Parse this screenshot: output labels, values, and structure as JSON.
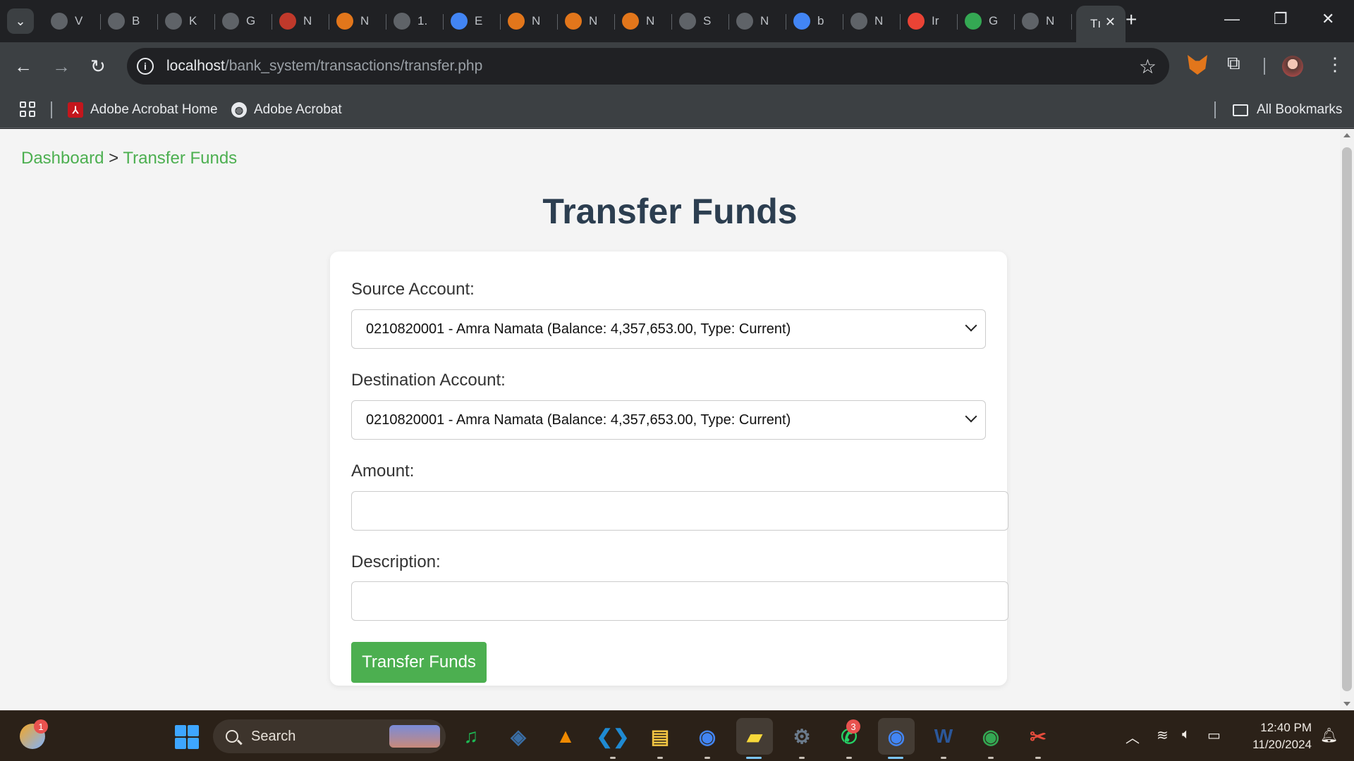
{
  "browser": {
    "tabs": [
      {
        "icon": "chrome-icon",
        "label": "V",
        "color": "#5f6368"
      },
      {
        "icon": "openai-icon",
        "label": "B",
        "color": "#5f6368"
      },
      {
        "icon": "github-icon",
        "label": "K",
        "color": "#5f6368"
      },
      {
        "icon": "globe-icon",
        "label": "G",
        "color": "#5f6368"
      },
      {
        "icon": "bookmark-icon",
        "label": "N",
        "color": "#c0392b"
      },
      {
        "icon": "metamask-icon",
        "label": "N",
        "color": "#e2761b"
      },
      {
        "icon": "globe-icon",
        "label": "1.",
        "color": "#5f6368"
      },
      {
        "icon": "cloud-icon",
        "label": "E",
        "color": "#4285f4"
      },
      {
        "icon": "metamask-icon",
        "label": "N",
        "color": "#e2761b"
      },
      {
        "icon": "metamask-icon",
        "label": "N",
        "color": "#e2761b"
      },
      {
        "icon": "metamask-icon",
        "label": "N",
        "color": "#e2761b"
      },
      {
        "icon": "chart-icon",
        "label": "S",
        "color": "#5f6368"
      },
      {
        "icon": "github-icon",
        "label": "N",
        "color": "#5f6368"
      },
      {
        "icon": "google-icon",
        "label": "b",
        "color": "#4285f4"
      },
      {
        "icon": "chrome-icon",
        "label": "N",
        "color": "#5f6368"
      },
      {
        "icon": "gmail-icon",
        "label": "Ir",
        "color": "#ea4335"
      },
      {
        "icon": "google-lens-icon",
        "label": "G",
        "color": "#34a853"
      },
      {
        "icon": "chrome-icon",
        "label": "N",
        "color": "#5f6368"
      }
    ],
    "active_tab": {
      "label": "Tı"
    },
    "url": {
      "host": "localhost",
      "path": "/bank_system/transactions/transfer.php"
    },
    "bookmarks": [
      {
        "label": "Adobe Acrobat Home"
      },
      {
        "label": "Adobe Acrobat"
      }
    ],
    "all_bookmarks_label": "All Bookmarks"
  },
  "page": {
    "breadcrumb": {
      "home": "Dashboard",
      "separator": ">",
      "current": "Transfer Funds"
    },
    "title": "Transfer Funds",
    "form": {
      "source_label": "Source Account:",
      "source_value": "0210820001 - Amra Namata (Balance: 4,357,653.00, Type: Current)",
      "destination_label": "Destination Account:",
      "destination_value": "0210820001 - Amra Namata (Balance: 4,357,653.00, Type: Current)",
      "amount_label": "Amount:",
      "amount_value": "",
      "description_label": "Description:",
      "description_value": "",
      "submit_label": "Transfer Funds"
    },
    "colors": {
      "accent": "#4caf50",
      "title": "#2c3e50",
      "background": "#f4f4f4"
    }
  },
  "taskbar": {
    "weather_badge": "1",
    "search_placeholder": "Search",
    "apps": [
      {
        "name": "spotify",
        "color": "#1db954",
        "glyph": "♫"
      },
      {
        "name": "virtualbox",
        "color": "#3a6ea5",
        "glyph": "◈"
      },
      {
        "name": "vlc",
        "color": "#f08a00",
        "glyph": "▲"
      },
      {
        "name": "vscode",
        "color": "#1f8ad2",
        "glyph": "❮❯"
      },
      {
        "name": "file-explorer",
        "color": "#f4c542",
        "glyph": "▤"
      },
      {
        "name": "chrome",
        "color": "#4285f4",
        "glyph": "◉"
      },
      {
        "name": "sticky-notes",
        "color": "#f7d83a",
        "glyph": "▰"
      },
      {
        "name": "settings",
        "color": "#6b7b8c",
        "glyph": "⚙"
      },
      {
        "name": "whatsapp",
        "color": "#25d366",
        "glyph": "✆"
      },
      {
        "name": "chrome-profile",
        "color": "#4285f4",
        "glyph": "◉"
      },
      {
        "name": "word",
        "color": "#2b579a",
        "glyph": "W"
      },
      {
        "name": "chrome-dev",
        "color": "#34a853",
        "glyph": "◉"
      },
      {
        "name": "snipping-tool",
        "color": "#e74c3c",
        "glyph": "✂"
      }
    ],
    "whatsapp_badge": "3",
    "time": "12:40 PM",
    "date": "11/20/2024"
  }
}
